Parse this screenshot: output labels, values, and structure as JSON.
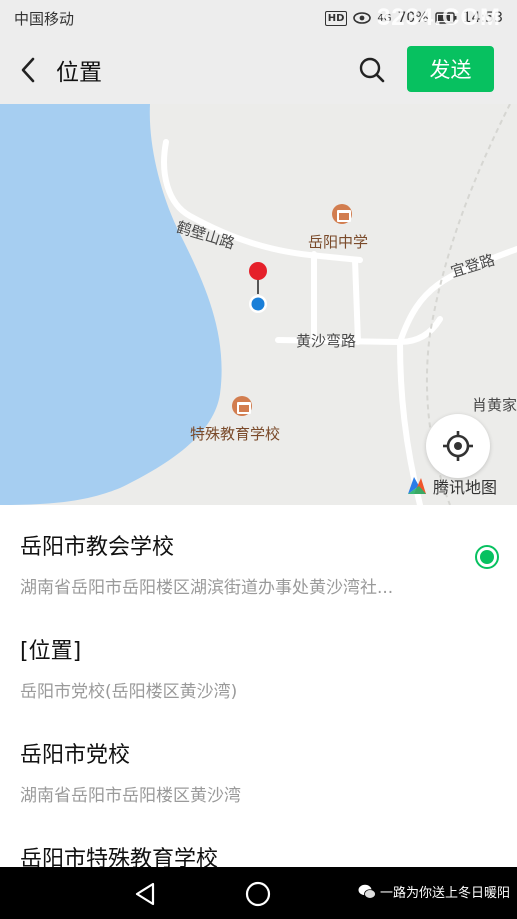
{
  "status_bar": {
    "carrier": "中国移动",
    "hd": "HD",
    "signal": "4G",
    "battery_text": "70%",
    "time": "14:53",
    "watermark": "3234.COM"
  },
  "header": {
    "back_icon": "chevron-left-icon",
    "title": "位置",
    "search_icon": "search-icon",
    "send_label": "发送",
    "send_color": "#07c160"
  },
  "map": {
    "road_labels": [
      "鹤壁山路",
      "宜登路",
      "黄沙弯路",
      "肖黄家"
    ],
    "pois": [
      "岳阳中学",
      "特殊教育学校"
    ],
    "water_color": "#a6cef1",
    "pin_color": "#e5202a",
    "dot_color": "#1a7fd8",
    "locate_icon": "locate-icon",
    "provider": "腾讯地图"
  },
  "results": [
    {
      "name": "岳阳市教会学校",
      "address": "湖南省岳阳市岳阳楼区湖滨街道办事处黄沙湾社...",
      "selected": true
    },
    {
      "name": "[位置]",
      "address": "岳阳市党校(岳阳楼区黄沙湾)",
      "selected": false
    },
    {
      "name": "岳阳市党校",
      "address": "湖南省岳阳市岳阳楼区黄沙湾",
      "selected": false
    },
    {
      "name": "岳阳市特殊教育学校",
      "address": "",
      "selected": false
    }
  ],
  "nav_bar": {
    "back": "triangle-back-icon",
    "home": "circle-home-icon",
    "wechat_tag": "一路为你送上冬日暖阳"
  }
}
